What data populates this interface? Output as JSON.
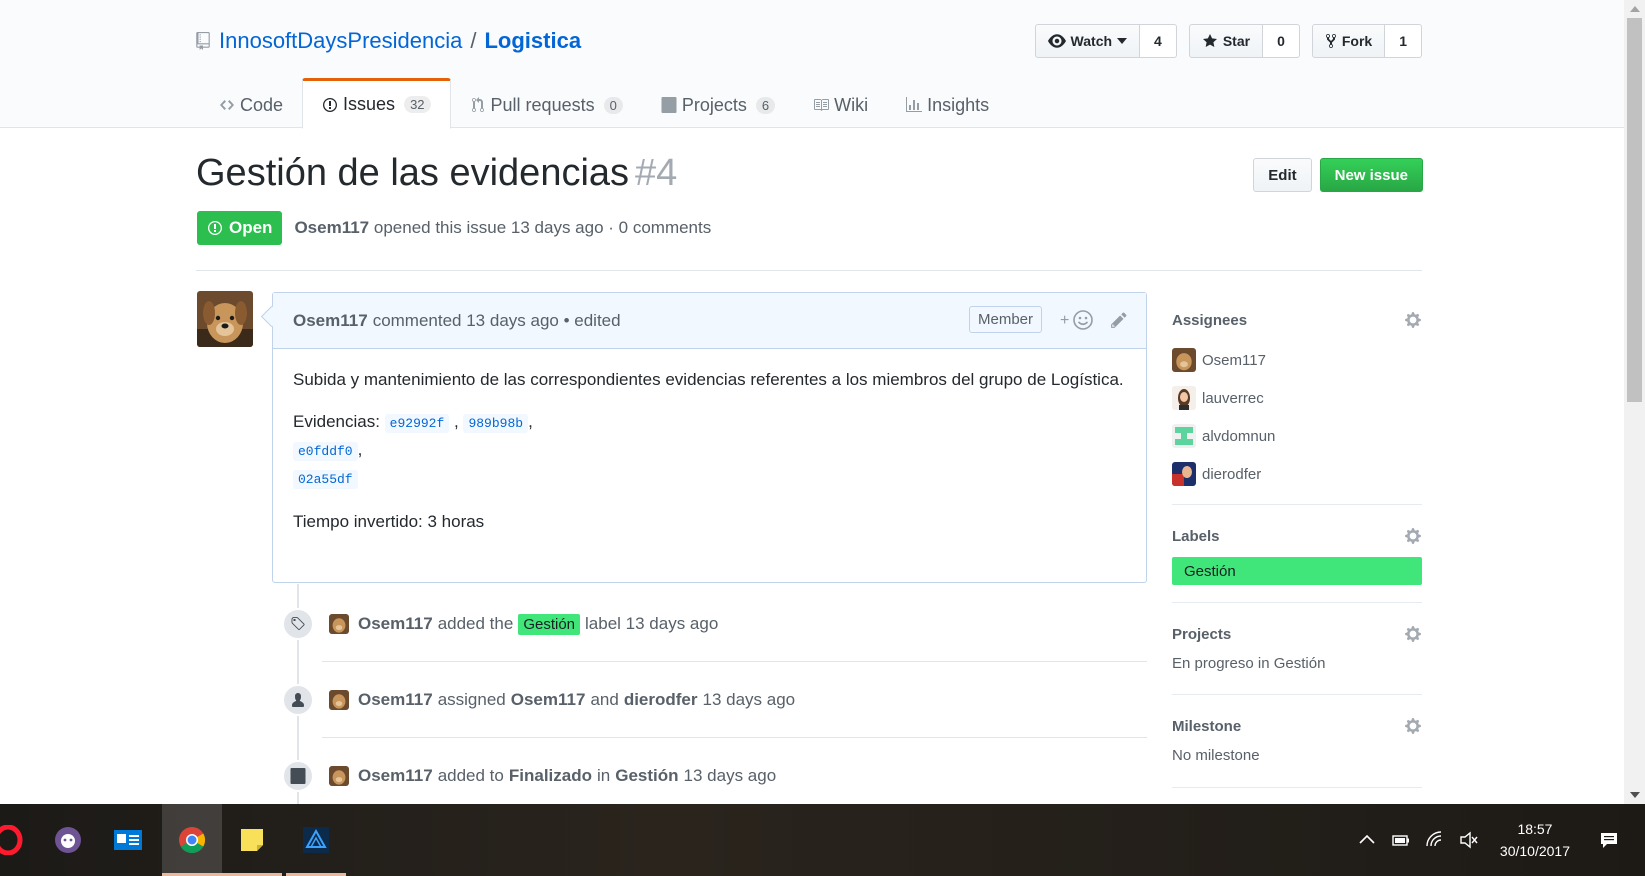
{
  "repo": {
    "owner": "InnosoftDaysPresidencia",
    "separator": "/",
    "name": "Logistica"
  },
  "actions": {
    "watch_label": "Watch",
    "watch_count": "4",
    "star_label": "Star",
    "star_count": "0",
    "fork_label": "Fork",
    "fork_count": "1"
  },
  "tabs": [
    {
      "label": "Code",
      "icon": "code-icon"
    },
    {
      "label": "Issues",
      "count": "32",
      "icon": "issue-opened-icon",
      "selected": true
    },
    {
      "label": "Pull requests",
      "count": "0",
      "icon": "git-pull-request-icon"
    },
    {
      "label": "Projects",
      "count": "6",
      "icon": "project-icon"
    },
    {
      "label": "Wiki",
      "icon": "book-icon"
    },
    {
      "label": "Insights",
      "icon": "graph-icon"
    }
  ],
  "issue": {
    "title": "Gestión de las evidencias",
    "number": "#4",
    "edit_label": "Edit",
    "new_issue_label": "New issue",
    "state": "Open",
    "author": "Osem117",
    "meta_text": "opened this issue 13 days ago · 0 comments"
  },
  "comment": {
    "author": "Osem117",
    "meta": "commented 13 days ago • edited",
    "badge": "Member",
    "body_p1": "Subida y mantenimiento de las correspondientes evidencias referentes a los miembros del grupo de Logística.",
    "evidencias_label": "Evidencias:",
    "commits": [
      "e92992f",
      "989b98b",
      "e0fddf0",
      "02a55df"
    ],
    "tiempo": "Tiempo invertido: 3 horas"
  },
  "timeline": [
    {
      "icon": "tag-icon",
      "actor": "Osem117",
      "pre": "added the",
      "label": "Gestión",
      "post": "label 13 days ago"
    },
    {
      "icon": "person-icon",
      "actor": "Osem117",
      "pre": "assigned",
      "a": "Osem117",
      "and": "and",
      "b": "dierodfer",
      "post": "13 days ago"
    },
    {
      "icon": "project-icon",
      "actor": "Osem117",
      "pre": "added to",
      "a": "Finalizado",
      "in": "in",
      "b": "Gestión",
      "post": "13 days ago"
    }
  ],
  "sidebar": {
    "assignees_heading": "Assignees",
    "assignees": [
      "Osem117",
      "lauverrec",
      "alvdomnun",
      "dierodfer"
    ],
    "labels_heading": "Labels",
    "label": "Gestión",
    "label_color": "#40e67a",
    "projects_heading": "Projects",
    "project_value": "En progreso in Gestión",
    "milestone_heading": "Milestone",
    "milestone_value": "No milestone"
  },
  "taskbar": {
    "time": "18:57",
    "date": "30/10/2017"
  },
  "colors": {
    "accent": "#0366d6",
    "open_green": "#2cbe4e",
    "tab_accent": "#e36209"
  }
}
